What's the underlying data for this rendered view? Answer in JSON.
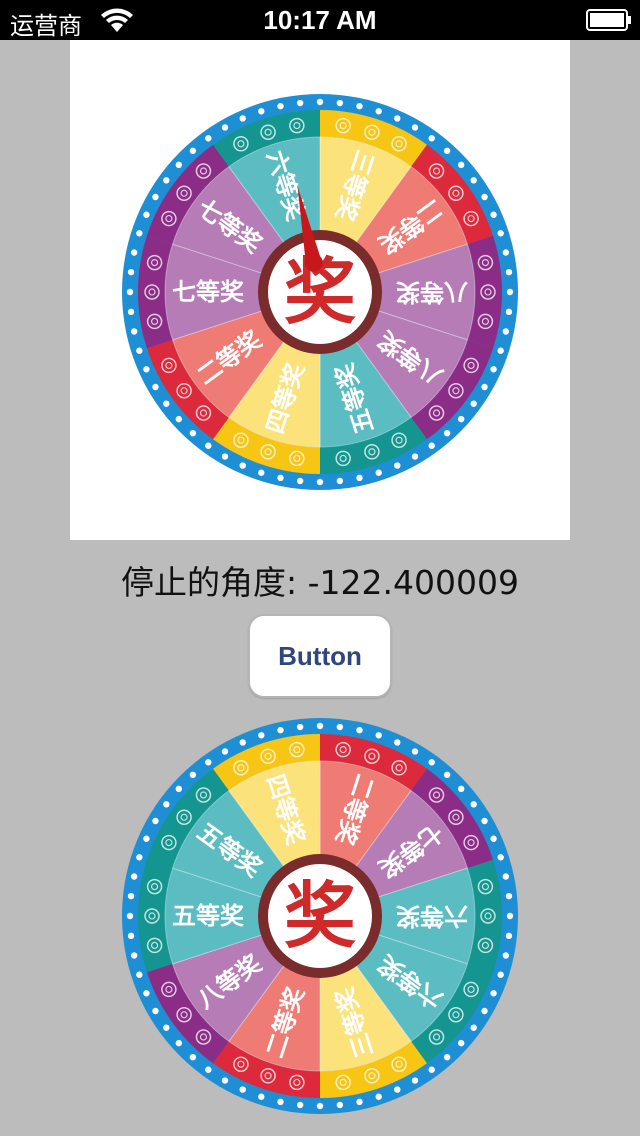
{
  "status_bar": {
    "carrier": "运营商",
    "time": "10:17 AM"
  },
  "result": {
    "label": "停止的角度: -122.400009"
  },
  "action": {
    "button_label": "Button"
  },
  "wheel_center_text": "奖",
  "wheel_top": {
    "rotation_deg": 0,
    "segments": [
      {
        "label": "三等奖",
        "bg": "#fbe27a",
        "outer": "#f7c514"
      },
      {
        "label": "二等奖",
        "bg": "#ee7b74",
        "outer": "#dc2a3c"
      },
      {
        "label": "八等奖",
        "bg": "#b67cb6",
        "outer": "#8b2d86"
      },
      {
        "label": "八等奖",
        "bg": "#b67cb6",
        "outer": "#8b2d86"
      },
      {
        "label": "五等奖",
        "bg": "#5bbcc2",
        "outer": "#14958f"
      },
      {
        "label": "四等奖",
        "bg": "#fbe27a",
        "outer": "#f7c514"
      },
      {
        "label": "二等奖",
        "bg": "#ee7b74",
        "outer": "#dc2a3c"
      },
      {
        "label": "七等奖",
        "bg": "#b67cb6",
        "outer": "#8b2d86"
      },
      {
        "label": "七等奖",
        "bg": "#b67cb6",
        "outer": "#8b2d86"
      },
      {
        "label": "六等奖",
        "bg": "#5bbcc2",
        "outer": "#14958f"
      }
    ]
  },
  "wheel_bottom": {
    "rotation_deg": 0,
    "segments": [
      {
        "label": "二等奖",
        "bg": "#ee7b74",
        "outer": "#dc2a3c"
      },
      {
        "label": "七等奖",
        "bg": "#b67cb6",
        "outer": "#8b2d86"
      },
      {
        "label": "六等奖",
        "bg": "#5bbcc2",
        "outer": "#14958f"
      },
      {
        "label": "六等奖",
        "bg": "#5bbcc2",
        "outer": "#14958f"
      },
      {
        "label": "三等奖",
        "bg": "#fbe27a",
        "outer": "#f7c514"
      },
      {
        "label": "二等奖",
        "bg": "#ee7b74",
        "outer": "#dc2a3c"
      },
      {
        "label": "八等奖",
        "bg": "#b67cb6",
        "outer": "#8b2d86"
      },
      {
        "label": "五等奖",
        "bg": "#5bbcc2",
        "outer": "#14958f"
      },
      {
        "label": "五等奖",
        "bg": "#5bbcc2",
        "outer": "#14958f"
      },
      {
        "label": "四等奖",
        "bg": "#fbe27a",
        "outer": "#f7c514"
      }
    ]
  },
  "colors": {
    "ring": "#1f8fd5",
    "hub_ring": "#7a2b2b",
    "hub_text": "#cf2a2a",
    "pointer": "#c7161c",
    "button_text": "#30477a"
  },
  "icons": {
    "wifi": "wifi-icon",
    "battery": "battery-icon",
    "pointer": "pointer-icon"
  }
}
